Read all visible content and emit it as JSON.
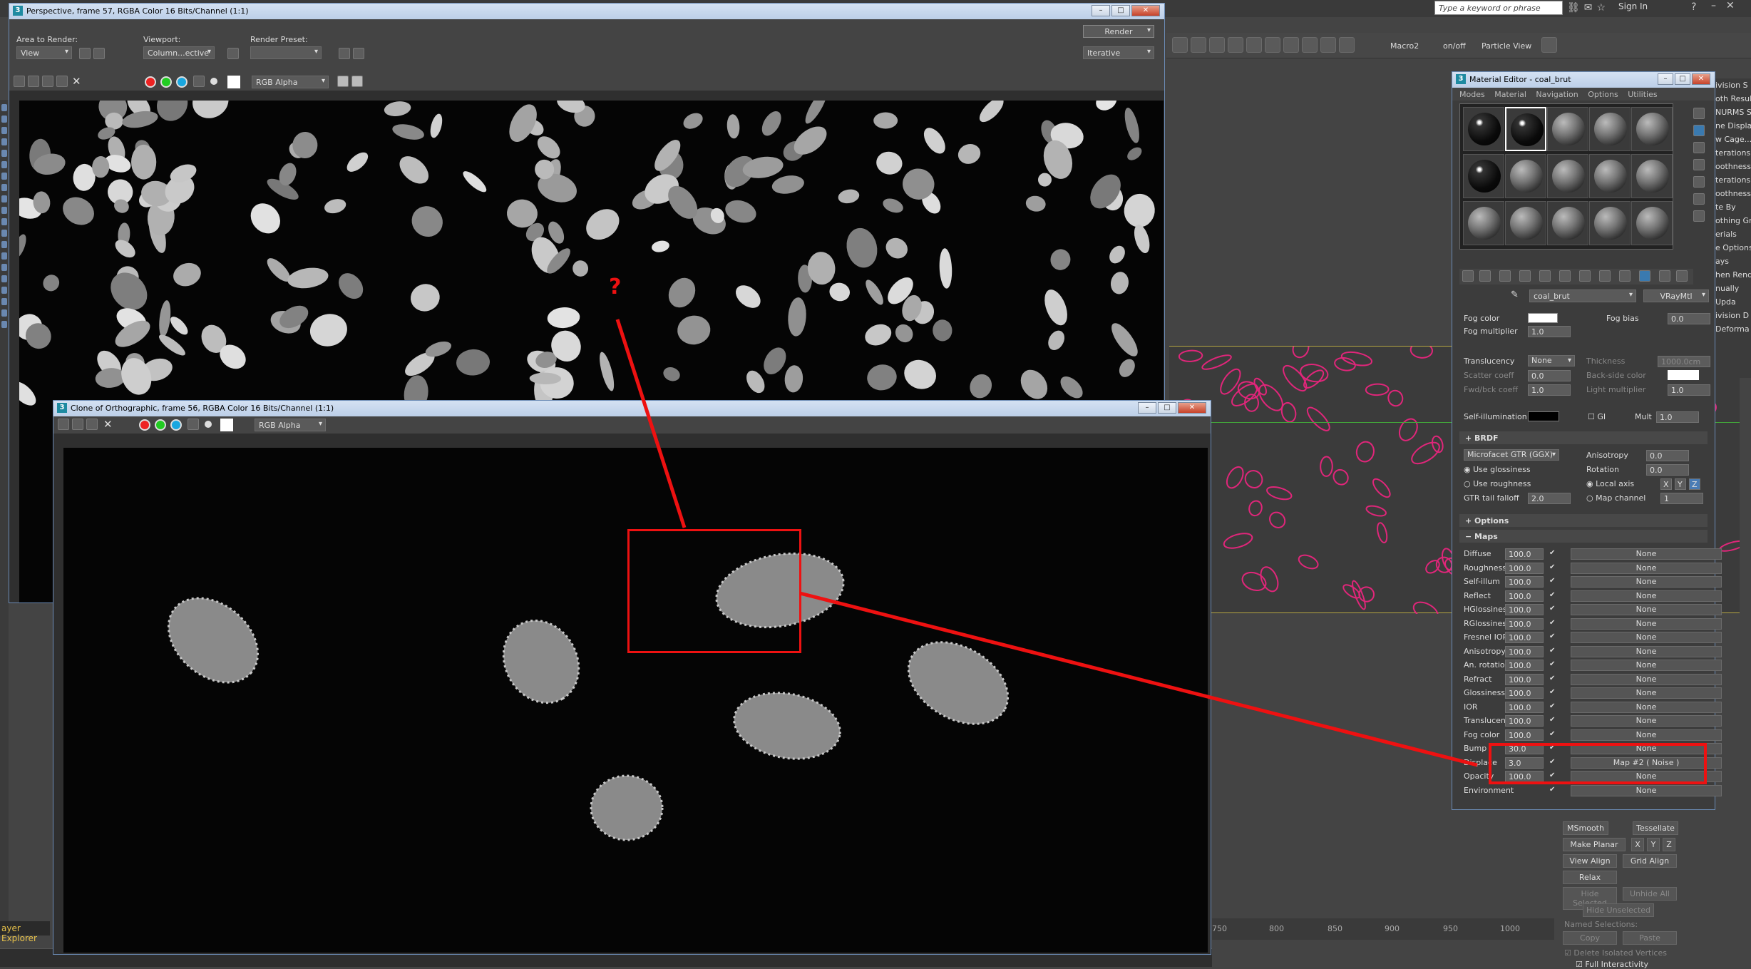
{
  "topbar": {
    "search_placeholder": "Type a keyword or phrase",
    "signin": "Sign In"
  },
  "main_toolbar": {
    "labels": [
      "Macro2",
      "on/off",
      "Particle View"
    ]
  },
  "right_cmd_panel": {
    "lines": [
      "ivision S",
      "oth Result",
      "NURMS S",
      "ne Display",
      "w Cage...",
      "",
      "terations:",
      "oothness:",
      "",
      "terations:",
      "oothness:",
      "te By",
      "othing Gr",
      "erials",
      "e Options",
      "ays",
      "hen Rende",
      "nually",
      "Upda",
      "",
      "ivision D",
      "Deforma"
    ]
  },
  "bottom_panel": {
    "msmooth": "MSmooth",
    "tessellate": "Tessellate",
    "make_planar": "Make Planar",
    "x": "X",
    "y": "Y",
    "z": "Z",
    "view_align": "View Align",
    "grid_align": "Grid Align",
    "relax": "Relax",
    "hide_selected": "Hide Selected",
    "unhide_all": "Unhide All",
    "hide_unselected": "Hide Unselected",
    "named_selections": "Named Selections:",
    "copy": "Copy",
    "paste": "Paste",
    "delete_isolated": "Delete Isolated Vertices",
    "full_interactivity": "Full Interactivity"
  },
  "ruler": {
    "ticks": [
      "750",
      "800",
      "850",
      "900",
      "950",
      "1000"
    ]
  },
  "layer_explorer": "ayer Explorer",
  "vfb1": {
    "title": "Perspective, frame 57, RGBA Color 16 Bits/Channel (1:1)",
    "area_label": "Area to Render:",
    "area_value": "View",
    "viewport_label": "Viewport:",
    "viewport_value": "Column...ective",
    "preset_label": "Render Preset:",
    "preset_value": "",
    "render_button": "Render",
    "mode_value": "Iterative",
    "channel_value": "RGB Alpha"
  },
  "vfb2": {
    "title": "Clone of Orthographic, frame 56, RGBA Color 16 Bits/Channel (1:1)",
    "channel_value": "RGB Alpha"
  },
  "annotation": {
    "question_mark": "?"
  },
  "material_editor": {
    "title": "Material Editor - coal_brut",
    "menu": [
      "Modes",
      "Material",
      "Navigation",
      "Options",
      "Utilities"
    ],
    "material_name": "coal_brut",
    "material_type": "VRayMtl",
    "fog_color_label": "Fog color",
    "fog_bias_label": "Fog bias",
    "fog_bias_value": "0.0",
    "fog_multiplier_label": "Fog multiplier",
    "fog_multiplier_value": "1.0",
    "translucency_label": "Translucency",
    "translucency_value": "None",
    "thickness_label": "Thickness",
    "thickness_value": "1000.0cm",
    "scatter_label": "Scatter coeff",
    "scatter_value": "0.0",
    "backside_label": "Back-side color",
    "fwdbck_label": "Fwd/bck coeff",
    "fwdbck_value": "1.0",
    "light_mult_label": "Light multiplier",
    "light_mult_value": "1.0",
    "selfillum_label": "Self-illumination",
    "gi_label": "GI",
    "mult_label": "Mult",
    "mult_value": "1.0",
    "brdf_header": "BRDF",
    "brdf_type": "Microfacet GTR (GGX)",
    "anisotropy_label": "Anisotropy",
    "anisotropy_value": "0.0",
    "use_glossiness": "Use glossiness",
    "rotation_label": "Rotation",
    "rotation_value": "0.0",
    "use_roughness": "Use roughness",
    "local_axis": "Local axis",
    "axis_x": "X",
    "axis_y": "Y",
    "axis_z": "Z",
    "gtr_label": "GTR tail falloff",
    "gtr_value": "2.0",
    "map_channel": "Map channel",
    "map_channel_value": "1",
    "options_header": "Options",
    "maps_header": "Maps",
    "maps": [
      {
        "name": "Diffuse",
        "value": "100.0",
        "map": "None"
      },
      {
        "name": "Roughness",
        "value": "100.0",
        "map": "None"
      },
      {
        "name": "Self-illum",
        "value": "100.0",
        "map": "None"
      },
      {
        "name": "Reflect",
        "value": "100.0",
        "map": "None"
      },
      {
        "name": "HGlossiness",
        "value": "100.0",
        "map": "None"
      },
      {
        "name": "RGlossiness",
        "value": "100.0",
        "map": "None"
      },
      {
        "name": "Fresnel IOR",
        "value": "100.0",
        "map": "None"
      },
      {
        "name": "Anisotropy",
        "value": "100.0",
        "map": "None"
      },
      {
        "name": "An. rotation",
        "value": "100.0",
        "map": "None"
      },
      {
        "name": "Refract",
        "value": "100.0",
        "map": "None"
      },
      {
        "name": "Glossiness",
        "value": "100.0",
        "map": "None"
      },
      {
        "name": "IOR",
        "value": "100.0",
        "map": "None"
      },
      {
        "name": "Translucent",
        "value": "100.0",
        "map": "None"
      },
      {
        "name": "Fog color",
        "value": "100.0",
        "map": "None"
      },
      {
        "name": "Bump",
        "value": "30.0",
        "map": "None"
      },
      {
        "name": "Displace",
        "value": "3.0",
        "map": "Map #2 ( Noise )"
      },
      {
        "name": "Opacity",
        "value": "100.0",
        "map": "None"
      },
      {
        "name": "Environment",
        "value": "",
        "map": "None"
      }
    ]
  }
}
